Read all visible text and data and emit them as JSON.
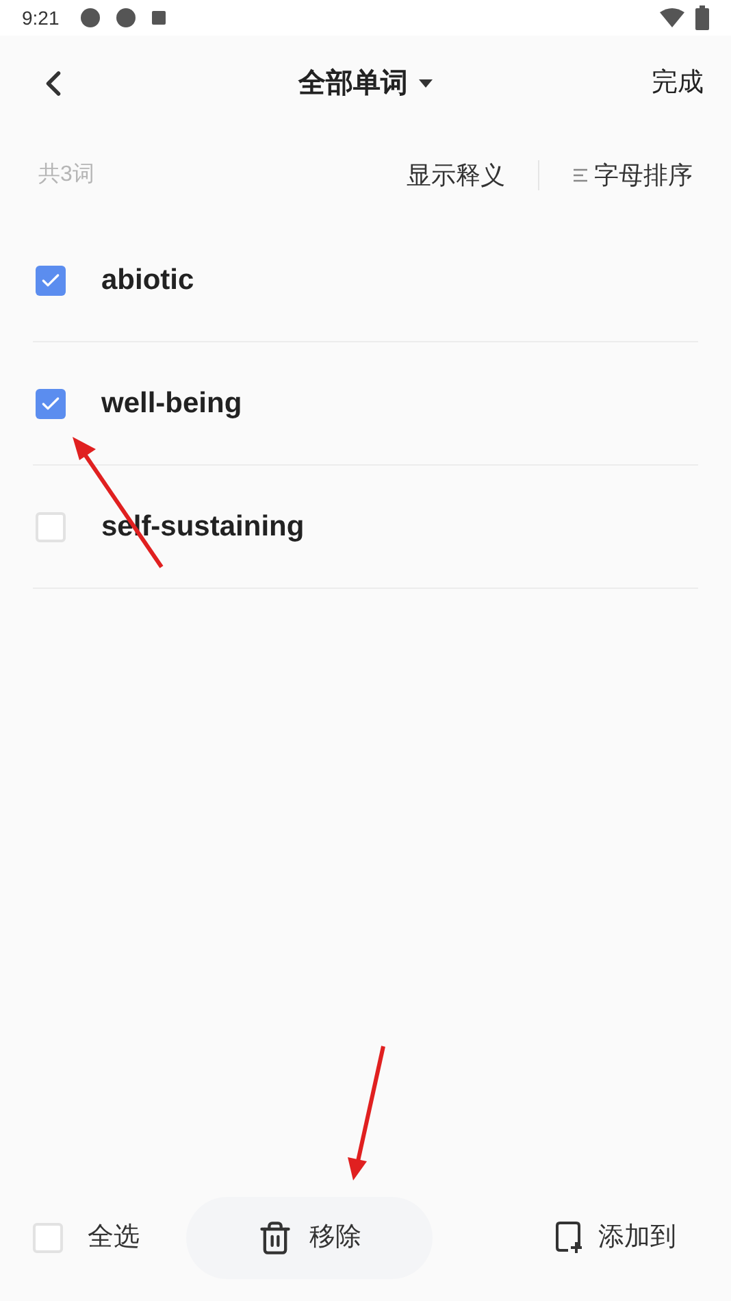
{
  "status_bar": {
    "time": "9:21"
  },
  "header": {
    "title": "全部单词",
    "done": "完成"
  },
  "toolbar": {
    "count": "共3词",
    "show_meaning": "显示释义",
    "sort": "字母排序"
  },
  "words": [
    {
      "word": "abiotic",
      "checked": true
    },
    {
      "word": "well-being",
      "checked": true
    },
    {
      "word": "self-sustaining",
      "checked": false
    }
  ],
  "bottom_bar": {
    "select_all": {
      "label": "全选",
      "checked": false
    },
    "remove": "移除",
    "add_to": "添加到"
  }
}
